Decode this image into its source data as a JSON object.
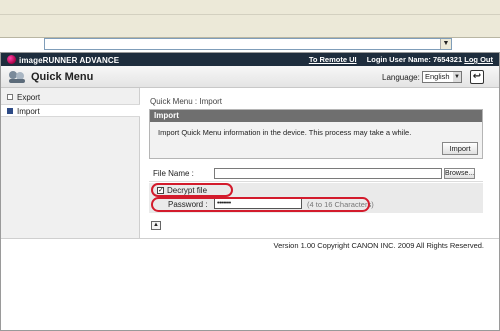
{
  "browser": {
    "address_dropdown": "▼"
  },
  "header": {
    "brand": "imageRUNNER ADVANCE",
    "remote_ui_link": "To Remote UI",
    "login_label": "Login User Name: 7654321",
    "logout_link": "Log Out"
  },
  "titlebar": {
    "title": "Quick Menu",
    "language_label": "Language:",
    "language_value": "English",
    "refresh_icon": "↩"
  },
  "sidebar": {
    "items": [
      {
        "label": "Export"
      },
      {
        "label": "Import"
      }
    ]
  },
  "main": {
    "breadcrumb": "Quick Menu : Import",
    "panel_title": "Import",
    "panel_text": "Import Quick Menu information in the device. This process may take a while.",
    "import_button": "Import",
    "file_name_label": "File Name :",
    "browse_button": "Browse...",
    "decrypt_label": "Decrypt file",
    "decrypt_checked": "✓",
    "password_label": "Password :",
    "password_value": "•••••••",
    "password_hint": "(4 to 16 Characters)",
    "back_to_top": "▲"
  },
  "footer": {
    "text": "Version 1.00 Copyright CANON INC. 2009 All Rights Reserved."
  },
  "colors": {
    "header_bg": "#1e2d3d",
    "highlight_oval": "#d31b2c",
    "panel_head": "#6f6f6f"
  }
}
